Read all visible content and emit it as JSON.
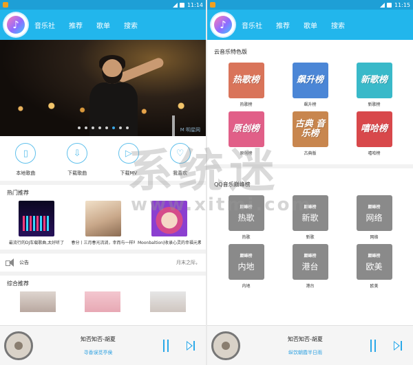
{
  "left": {
    "status_time": "11:14",
    "nav_tabs": [
      "音乐社",
      "推荐",
      "歌单",
      "搜索"
    ],
    "banner_watermark": "M 明星网",
    "banner_dots": 8,
    "banner_active_dot": 5,
    "quick": [
      {
        "label": "本地歌曲",
        "icon": "phone-icon"
      },
      {
        "label": "下载歌曲",
        "icon": "download-icon"
      },
      {
        "label": "下载MV",
        "icon": "play-icon"
      },
      {
        "label": "我喜欢",
        "icon": "heart-icon"
      }
    ],
    "hot_title": "热门推荐",
    "hot": [
      {
        "text": "最流行的DJ车载歌曲,太好听了"
      },
      {
        "text": "春分丨三月春光流淌，幸而与一样呼吸"
      },
      {
        "text": "Moonbaltion|收录心灵的幸福元素"
      }
    ],
    "notice_label": "公告",
    "notice_text": "月末之际，",
    "mix_title": "综合推荐",
    "player": {
      "title": "知否知否-胡夏",
      "subtitle": "寻香误觅亭侯"
    }
  },
  "right": {
    "status_time": "11:15",
    "nav_tabs": [
      "音乐社",
      "推荐",
      "歌单",
      "搜索"
    ],
    "cloud_title": "云音乐特色版",
    "cloud_charts": [
      {
        "cover": "热歌榜",
        "name": "热歌榜",
        "color": "#d9745a"
      },
      {
        "cover": "飙升榜",
        "name": "飙升榜",
        "color": "#4b86d6"
      },
      {
        "cover": "新歌榜",
        "name": "新歌榜",
        "color": "#39b9c9"
      },
      {
        "cover": "原创榜",
        "name": "原创榜",
        "color": "#e15f88"
      },
      {
        "cover": "古典 音乐榜",
        "name": "古典版",
        "color": "#c8864e"
      },
      {
        "cover": "嘻哈榜",
        "name": "嘻哈榜",
        "color": "#d8484b"
      }
    ],
    "qq_title": "QQ音乐巅峰榜",
    "qq_charts": [
      {
        "brand": "巅峰榜",
        "cover": "热歌",
        "name": "热歌"
      },
      {
        "brand": "巅峰榜",
        "cover": "新歌",
        "name": "新歌"
      },
      {
        "brand": "巅峰榜",
        "cover": "网络",
        "name": "网络"
      },
      {
        "brand": "巅峰榜",
        "cover": "内地",
        "name": "内地"
      },
      {
        "brand": "巅峰榜",
        "cover": "港台",
        "name": "港台"
      },
      {
        "brand": "巅峰榜",
        "cover": "欧美",
        "name": "欧美"
      }
    ],
    "player": {
      "title": "知否知否-胡夏",
      "subtitle": "纵饮朝霞半日雨"
    }
  },
  "watermark": {
    "big": "系统迷",
    "url": "www.xitmi.com"
  }
}
